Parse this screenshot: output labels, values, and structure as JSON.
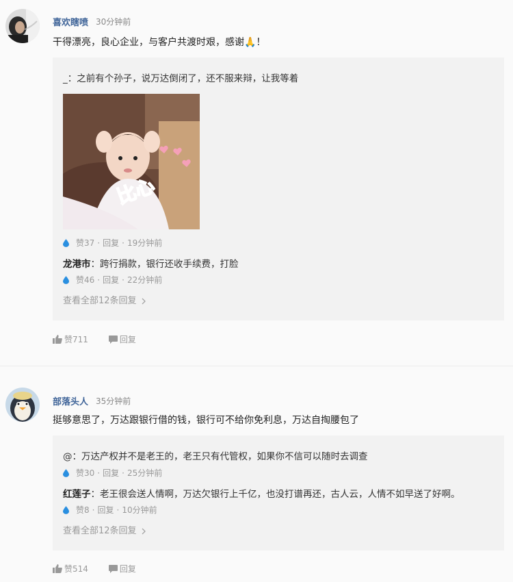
{
  "comments": [
    {
      "username": "喜欢瞎喷",
      "time": "30分钟前",
      "text": "干得漂亮，良心企业，与客户共渡时艰，感谢🙏！",
      "avatar_icon": "smoking-person-avatar",
      "replies": [
        {
          "text": "_：之前有个孙子，说万达倒闭了，还不服来辩，让我等着",
          "likes": "赞37",
          "reply_label": "回复",
          "time": "19分钟前"
        },
        {
          "author": "龙港市",
          "text": "：跨行捐款，银行还收手续费，打脸",
          "likes": "赞46",
          "reply_label": "回复",
          "time": "22分钟前"
        }
      ],
      "gif_caption": "比心",
      "view_all": "查看全部12条回复",
      "likes": "赞711",
      "reply_label": "回复"
    },
    {
      "username": "部落头人",
      "time": "35分钟前",
      "text": "挺够意思了，万达跟银行借的钱，银行可不给你免利息，万达自掏腰包了",
      "avatar_icon": "penguin-avatar",
      "replies": [
        {
          "text": "@：万达产权并不是老王的，老王只有代管权，如果你不信可以随时去调查",
          "likes": "赞30",
          "reply_label": "回复",
          "time": "25分钟前"
        },
        {
          "author": "红莲子",
          "text": "：老王很会送人情啊，万达欠银行上千亿，也没打谱再还，古人云，人情不如早送了好啊。",
          "likes": "赞8",
          "reply_label": "回复",
          "time": "10分钟前"
        }
      ],
      "view_all": "查看全部12条回复",
      "likes": "赞514",
      "reply_label": "回复"
    }
  ],
  "colors": {
    "username": "#406599",
    "drop": "#2a8fe0",
    "reply_bg": "#f2f2f2"
  },
  "separator": "·"
}
